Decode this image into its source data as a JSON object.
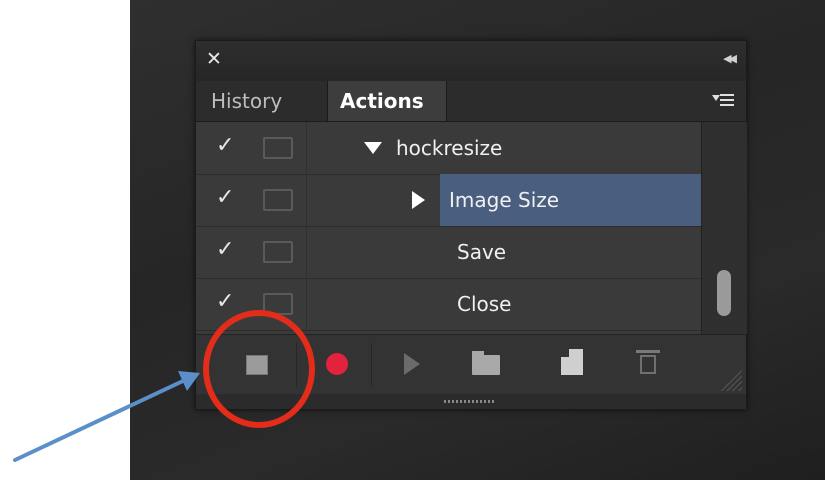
{
  "panel": {
    "close_glyph": "✕",
    "collapse_glyph": "◀◀",
    "tabs": [
      {
        "label": "History",
        "active": false
      },
      {
        "label": "Actions",
        "active": true
      }
    ],
    "panel_menu_icon": "panel-menu-icon"
  },
  "actions": [
    {
      "checked": true,
      "expand": "down",
      "name": "hockresize",
      "selected": false
    },
    {
      "checked": true,
      "expand": "right",
      "name": "Image Size",
      "selected": true
    },
    {
      "checked": true,
      "expand": "none",
      "name": "Save",
      "selected": false
    },
    {
      "checked": true,
      "expand": "none",
      "name": "Close",
      "selected": false
    }
  ],
  "glyphs": {
    "check": "✓"
  },
  "toolbar": {
    "buttons": [
      "stop-recording",
      "begin-recording",
      "play-selection",
      "create-new-set",
      "create-new-action",
      "delete"
    ]
  },
  "colors": {
    "record": "#e3223e",
    "selection": "#4a5f80",
    "annotation_circle": "#e32d1a",
    "annotation_arrow": "#5b8fc9"
  }
}
